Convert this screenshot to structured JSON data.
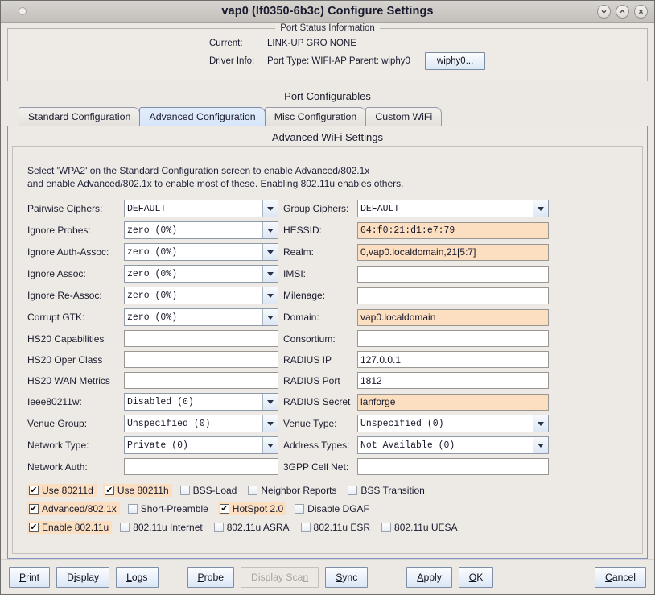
{
  "window": {
    "title": "vap0  (lf0350-6b3c) Configure Settings",
    "controls": [
      {
        "name": "minimize",
        "glyph": "chevron-down"
      },
      {
        "name": "maximize",
        "glyph": "chevron-up"
      },
      {
        "name": "close",
        "glyph": "x"
      }
    ]
  },
  "status": {
    "title": "Port Status Information",
    "current_label": "Current:",
    "current_value": "LINK-UP GRO  NONE",
    "driver_label": "Driver Info:",
    "driver_value": "Port Type: WIFI-AP   Parent: wiphy0",
    "wiphy_button": "wiphy0..."
  },
  "configurables": {
    "heading": "Port Configurables",
    "tabs": [
      {
        "label": "Standard Configuration",
        "active": false
      },
      {
        "label": "Advanced Configuration",
        "active": true
      },
      {
        "label": "Misc Configuration",
        "active": false
      },
      {
        "label": "Custom WiFi",
        "active": false
      }
    ],
    "panel_title": "Advanced WiFi Settings",
    "hint_line1": "Select 'WPA2' on the Standard Configuration screen to enable Advanced/802.1x",
    "hint_line2": "and enable Advanced/802.1x to enable most of these. Enabling 802.11u enables others."
  },
  "fields": {
    "pairwise_ciphers": {
      "label": "Pairwise Ciphers:",
      "value": "DEFAULT",
      "type": "combo"
    },
    "group_ciphers": {
      "label": "Group Ciphers:",
      "value": "DEFAULT",
      "type": "combo"
    },
    "ignore_probes": {
      "label": "Ignore Probes:",
      "value": "zero (0%)",
      "type": "combo"
    },
    "hessid": {
      "label": "HESSID:",
      "value": "04:f0:21:d1:e7:79",
      "type": "text",
      "highlight": true
    },
    "ignore_auth_assoc": {
      "label": "Ignore Auth-Assoc:",
      "value": "zero (0%)",
      "type": "combo"
    },
    "realm": {
      "label": "Realm:",
      "value": "0,vap0.localdomain,21[5:7]",
      "type": "text",
      "highlight": true
    },
    "ignore_assoc": {
      "label": "Ignore Assoc:",
      "value": "zero (0%)",
      "type": "combo"
    },
    "imsi": {
      "label": "IMSI:",
      "value": "",
      "type": "text"
    },
    "ignore_re_assoc": {
      "label": "Ignore Re-Assoc:",
      "value": "zero (0%)",
      "type": "combo"
    },
    "milenage": {
      "label": "Milenage:",
      "value": "",
      "type": "text"
    },
    "corrupt_gtk": {
      "label": "Corrupt GTK:",
      "value": "zero (0%)",
      "type": "combo"
    },
    "domain": {
      "label": "Domain:",
      "value": "vap0.localdomain",
      "type": "text",
      "highlight": true
    },
    "hs20_capabilities": {
      "label": "HS20 Capabilities",
      "value": "",
      "type": "text"
    },
    "consortium": {
      "label": "Consortium:",
      "value": "",
      "type": "text"
    },
    "hs20_oper_class": {
      "label": "HS20 Oper Class",
      "value": "",
      "type": "text"
    },
    "radius_ip": {
      "label": "RADIUS IP",
      "value": "127.0.0.1",
      "type": "text"
    },
    "hs20_wan_metrics": {
      "label": "HS20 WAN Metrics",
      "value": "",
      "type": "text"
    },
    "radius_port": {
      "label": "RADIUS Port",
      "value": "1812",
      "type": "text"
    },
    "ieee80211w": {
      "label": "Ieee80211w:",
      "value": "Disabled (0)",
      "type": "combo"
    },
    "radius_secret": {
      "label": "RADIUS Secret",
      "value": "lanforge",
      "type": "text",
      "highlight": true
    },
    "venue_group": {
      "label": "Venue Group:",
      "value": "Unspecified (0)",
      "type": "combo"
    },
    "venue_type": {
      "label": "Venue Type:",
      "value": "Unspecified (0)",
      "type": "combo"
    },
    "network_type": {
      "label": "Network Type:",
      "value": "Private (0)",
      "type": "combo"
    },
    "address_types": {
      "label": "Address Types:",
      "value": "Not Available (0)",
      "type": "combo"
    },
    "network_auth": {
      "label": "Network Auth:",
      "value": "",
      "type": "text"
    },
    "cell_net_3gpp": {
      "label": "3GPP Cell Net:",
      "value": "",
      "type": "text"
    }
  },
  "checkbox_rows": [
    [
      {
        "label": "Use 80211d",
        "checked": true
      },
      {
        "label": "Use 80211h",
        "checked": true
      },
      {
        "label": "BSS-Load",
        "checked": false
      },
      {
        "label": "Neighbor Reports",
        "checked": false
      },
      {
        "label": "BSS Transition",
        "checked": false
      }
    ],
    [
      {
        "label": "Advanced/802.1x",
        "checked": true
      },
      {
        "label": "Short-Preamble",
        "checked": false
      },
      {
        "label": "HotSpot 2.0",
        "checked": true
      },
      {
        "label": "Disable DGAF",
        "checked": false
      }
    ],
    [
      {
        "label": "Enable 802.11u",
        "checked": true
      },
      {
        "label": "802.11u Internet",
        "checked": false
      },
      {
        "label": "802.11u ASRA",
        "checked": false
      },
      {
        "label": "802.11u ESR",
        "checked": false
      },
      {
        "label": "802.11u UESA",
        "checked": false
      }
    ]
  ],
  "buttons": {
    "print": {
      "label": "Print",
      "mnemonic": "P",
      "disabled": false
    },
    "display": {
      "label": "Display",
      "mnemonic": "i",
      "disabled": false
    },
    "logs": {
      "label": "Logs",
      "mnemonic": "L",
      "disabled": false
    },
    "probe": {
      "label": "Probe",
      "mnemonic": "P",
      "disabled": false
    },
    "display_scan": {
      "label": "Display Scan",
      "mnemonic": "n",
      "disabled": true
    },
    "sync": {
      "label": "Sync",
      "mnemonic": "S",
      "disabled": false
    },
    "apply": {
      "label": "Apply",
      "mnemonic": "A",
      "disabled": false
    },
    "ok": {
      "label": "OK",
      "mnemonic": "O",
      "disabled": false
    },
    "cancel": {
      "label": "Cancel",
      "mnemonic": "C",
      "disabled": false
    }
  },
  "colors": {
    "highlight_field": "#fbdfc0",
    "tab_active": "#d6e6fa",
    "panel_border": "#7d93c4",
    "window_bg": "#ece9e4"
  }
}
